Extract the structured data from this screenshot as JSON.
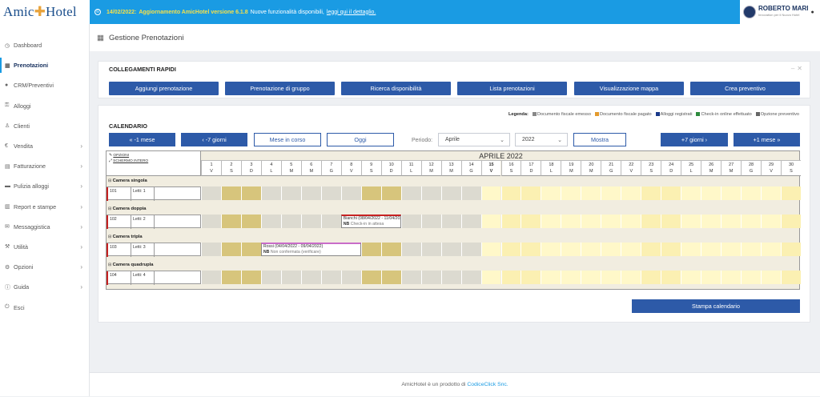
{
  "app": {
    "logo_pre": "Amic",
    "logo_o": "✚",
    "logo_post": "Hotel"
  },
  "topbar": {
    "date": "14/02/2022:",
    "title": "Aggiornamento AmicHotel versione 6.1.8",
    "text": "Nuove funzionalità disponibili,",
    "link": "leggi qui il dettaglio."
  },
  "user": {
    "name": "ROBERTO MARI",
    "sub": "Innovation per il Nuovo Hotel"
  },
  "sidebar": {
    "items": [
      {
        "icon": "◷",
        "label": "Dashboard",
        "chevron": false
      },
      {
        "icon": "▦",
        "label": "Prenotazioni",
        "chevron": false,
        "active": true
      },
      {
        "icon": "●",
        "label": "CRM/Preventivi",
        "chevron": false
      },
      {
        "icon": "⚿",
        "label": "Alloggi",
        "chevron": false
      },
      {
        "icon": "♙",
        "label": "Clienti",
        "chevron": false
      },
      {
        "icon": "€",
        "label": "Vendita",
        "chevron": true
      },
      {
        "icon": "▤",
        "label": "Fatturazione",
        "chevron": true
      },
      {
        "icon": "▬",
        "label": "Pulizia alloggi",
        "chevron": true
      },
      {
        "icon": "▥",
        "label": "Report e stampe",
        "chevron": true
      },
      {
        "icon": "✉",
        "label": "Messaggistica",
        "chevron": true
      },
      {
        "icon": "⚒",
        "label": "Utilità",
        "chevron": true
      },
      {
        "icon": "⚙",
        "label": "Opzioni",
        "chevron": true
      },
      {
        "icon": "ⓘ",
        "label": "Guida",
        "chevron": true
      },
      {
        "icon": "⏻",
        "label": "Esci",
        "chevron": false
      }
    ]
  },
  "page": {
    "title": "Gestione Prenotazioni"
  },
  "quick": {
    "title": "COLLEGAMENTI RAPIDI",
    "buttons": [
      "Aggiungi prenotazione",
      "Prenotazione di gruppo",
      "Ricerca disponibilità",
      "Lista prenotazioni",
      "Visualizzazione mappa",
      "Crea preventivo"
    ]
  },
  "legend": {
    "title": "Legenda:",
    "items": [
      {
        "label": "Documento fiscale emesso",
        "color": "#888888"
      },
      {
        "label": "Documento fiscale pagato",
        "color": "#e39a2d"
      },
      {
        "label": "Alloggi registrati",
        "color": "#1a3a8a"
      },
      {
        "label": "Check-in online effettuato",
        "color": "#2e8b3e"
      },
      {
        "label": "Opzione preventivo",
        "color": "#666666"
      }
    ]
  },
  "calendar": {
    "title": "CALENDARIO",
    "nav": {
      "prev_month": "« -1 mese",
      "prev_week": "‹ -7 giorni",
      "current": "Mese in corso",
      "today": "Oggi",
      "period_label": "Periodo:",
      "month_value": "Aprile",
      "year_value": "2022",
      "show": "Mostra",
      "next_week": "+7 giorni ›",
      "next_month": "+1 mese »"
    },
    "options": "OPZIONI",
    "fullscreen": "SCHERMO INTERO",
    "month_title": "APRILE 2022",
    "today_index": 14,
    "days": [
      {
        "n": "1",
        "d": "V"
      },
      {
        "n": "2",
        "d": "S"
      },
      {
        "n": "3",
        "d": "D"
      },
      {
        "n": "4",
        "d": "L"
      },
      {
        "n": "5",
        "d": "M"
      },
      {
        "n": "6",
        "d": "M"
      },
      {
        "n": "7",
        "d": "G"
      },
      {
        "n": "8",
        "d": "V"
      },
      {
        "n": "9",
        "d": "S"
      },
      {
        "n": "10",
        "d": "D"
      },
      {
        "n": "11",
        "d": "L"
      },
      {
        "n": "12",
        "d": "M"
      },
      {
        "n": "13",
        "d": "M"
      },
      {
        "n": "14",
        "d": "G"
      },
      {
        "n": "15",
        "d": "V"
      },
      {
        "n": "16",
        "d": "S"
      },
      {
        "n": "17",
        "d": "D"
      },
      {
        "n": "18",
        "d": "L"
      },
      {
        "n": "19",
        "d": "M"
      },
      {
        "n": "20",
        "d": "M"
      },
      {
        "n": "21",
        "d": "G"
      },
      {
        "n": "22",
        "d": "V"
      },
      {
        "n": "23",
        "d": "S"
      },
      {
        "n": "24",
        "d": "D"
      },
      {
        "n": "25",
        "d": "L"
      },
      {
        "n": "26",
        "d": "M"
      },
      {
        "n": "27",
        "d": "M"
      },
      {
        "n": "28",
        "d": "G"
      },
      {
        "n": "29",
        "d": "V"
      },
      {
        "n": "30",
        "d": "S"
      }
    ],
    "rooms": [
      {
        "category": "Camera singola",
        "number": "101",
        "beds": "Letti: 1"
      },
      {
        "category": "Camera doppia",
        "number": "102",
        "beds": "Letti: 2"
      },
      {
        "category": "Camera tripla",
        "number": "103",
        "beds": "Letti: 3"
      },
      {
        "category": "Camera quadrupla",
        "number": "104",
        "beds": "Letti: 4"
      }
    ],
    "bookings": [
      {
        "room": 1,
        "start": 7,
        "end": 10,
        "name": "Bianchi (08/04/2022 - 11/04/2022)",
        "note_label": "NB",
        "note": "Check-in in attesa",
        "color": "#c62222"
      },
      {
        "room": 2,
        "start": 3,
        "end": 8,
        "name": "Rossi (04/04/2022 - 09/04/2022)",
        "note_label": "NB",
        "note": "Non confermata (verificare)",
        "color": "#c86cc8"
      }
    ],
    "print": "Stampa calendario"
  },
  "footer": {
    "text": "AmicHotel è un prodotto di",
    "link": "CodiceClick Snc."
  }
}
